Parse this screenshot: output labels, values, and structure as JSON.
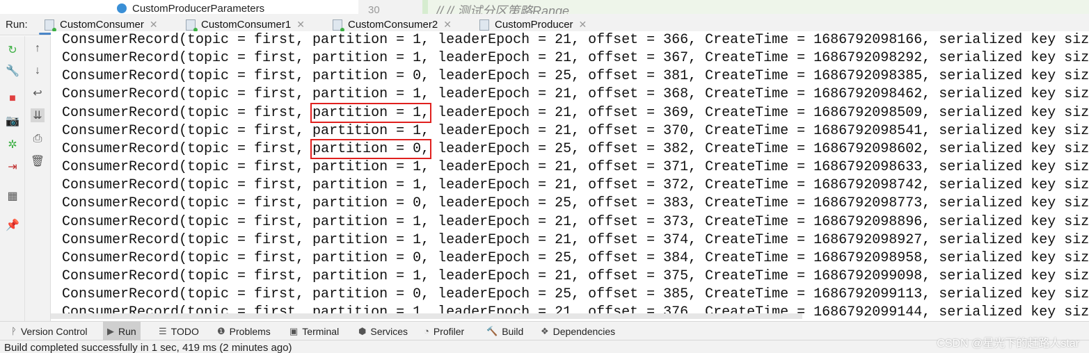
{
  "editor_strip": {
    "file": "CustomProducerParameters",
    "line_number": "30",
    "code": "//          // 测试分区策略Range"
  },
  "run": {
    "label": "Run:",
    "tabs": [
      {
        "label": "CustomConsumer",
        "active": true,
        "running": true
      },
      {
        "label": "CustomConsumer1",
        "running": true
      },
      {
        "label": "CustomConsumer2",
        "running": true
      },
      {
        "label": "CustomProducer",
        "running": false
      }
    ]
  },
  "left_toolbar": [
    "rerun-icon",
    "wrench-icon",
    "stop-icon",
    "camera-icon",
    "debug-icon",
    "login-icon",
    "layout-icon",
    "pin-icon"
  ],
  "right_toolbar": [
    "arrow-up-icon",
    "arrow-down-icon",
    "soft-wrap-icon",
    "scroll-to-end-icon",
    "print-icon",
    "trash-icon"
  ],
  "console": {
    "lines": [
      {
        "text": "ConsumerRecord(topic = first, partition = 1, leaderEpoch = 21, offset = 366, CreateTime = 1686792098166, serialized key siz"
      },
      {
        "text": "ConsumerRecord(topic = first, partition = 1, leaderEpoch = 21, offset = 367, CreateTime = 1686792098292, serialized key siz"
      },
      {
        "text": "ConsumerRecord(topic = first, partition = 0, leaderEpoch = 25, offset = 381, CreateTime = 1686792098385, serialized key siz"
      },
      {
        "text": "ConsumerRecord(topic = first, partition = 1, leaderEpoch = 21, offset = 368, CreateTime = 1686792098462, serialized key siz"
      },
      {
        "text": "ConsumerRecord(topic = first, partition = 1, leaderEpoch = 21, offset = 369, CreateTime = 1686792098509, serialized key siz",
        "highlight": "partition = 1,"
      },
      {
        "text": "ConsumerRecord(topic = first, partition = 1, leaderEpoch = 21, offset = 370, CreateTime = 1686792098541, serialized key siz"
      },
      {
        "text": "ConsumerRecord(topic = first, partition = 0, leaderEpoch = 25, offset = 382, CreateTime = 1686792098602, serialized key siz",
        "highlight": "partition = 0,"
      },
      {
        "text": "ConsumerRecord(topic = first, partition = 1, leaderEpoch = 21, offset = 371, CreateTime = 1686792098633, serialized key siz"
      },
      {
        "text": "ConsumerRecord(topic = first, partition = 1, leaderEpoch = 21, offset = 372, CreateTime = 1686792098742, serialized key siz"
      },
      {
        "text": "ConsumerRecord(topic = first, partition = 0, leaderEpoch = 25, offset = 383, CreateTime = 1686792098773, serialized key siz"
      },
      {
        "text": "ConsumerRecord(topic = first, partition = 1, leaderEpoch = 21, offset = 373, CreateTime = 1686792098896, serialized key siz"
      },
      {
        "text": "ConsumerRecord(topic = first, partition = 1, leaderEpoch = 21, offset = 374, CreateTime = 1686792098927, serialized key siz"
      },
      {
        "text": "ConsumerRecord(topic = first, partition = 0, leaderEpoch = 25, offset = 384, CreateTime = 1686792098958, serialized key siz"
      },
      {
        "text": "ConsumerRecord(topic = first, partition = 1, leaderEpoch = 21, offset = 375, CreateTime = 1686792099098, serialized key siz"
      },
      {
        "text": "ConsumerRecord(topic = first, partition = 0, leaderEpoch = 25, offset = 385, CreateTime = 1686792099113, serialized key siz"
      },
      {
        "text": "ConsumerRecord(topic = first, partition = 1, leaderEpoch = 21, offset = 376, CreateTime = 1686792099144, serialized key siz"
      }
    ]
  },
  "bottom_tools": [
    {
      "label": "Version Control",
      "icon": "branch-icon"
    },
    {
      "label": "Run",
      "icon": "run-icon",
      "active": true
    },
    {
      "label": "TODO",
      "icon": "list-icon"
    },
    {
      "label": "Problems",
      "icon": "problems-icon"
    },
    {
      "label": "Terminal",
      "icon": "terminal-icon"
    },
    {
      "label": "Services",
      "icon": "services-icon"
    },
    {
      "label": "Profiler",
      "icon": "profiler-icon"
    },
    {
      "label": "Build",
      "icon": "hammer-icon"
    },
    {
      "label": "Dependencies",
      "icon": "dependencies-icon"
    }
  ],
  "status": "Build completed successfully in 1 sec, 419 ms (2 minutes ago)",
  "watermark": "CSDN @星光下的赶路人star",
  "colors": {
    "highlight_box": "#e0201e",
    "active_tab_underline": "#4a86c8"
  }
}
